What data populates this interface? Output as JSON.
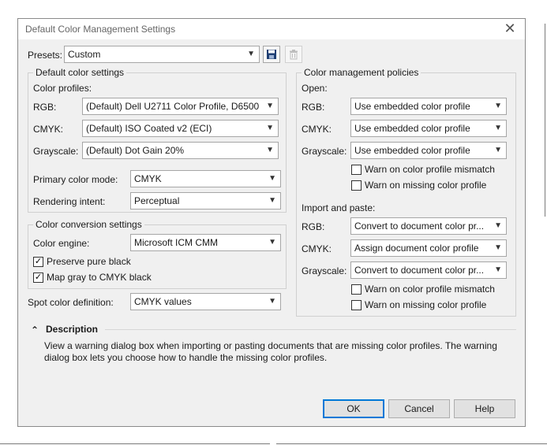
{
  "dialog": {
    "title": "Default Color Management Settings",
    "close_glyph": "✕"
  },
  "presets": {
    "label": "Presets:",
    "value": "Custom"
  },
  "default_color_settings": {
    "legend": "Default color settings",
    "profiles_label": "Color profiles:",
    "rgb_label": "RGB:",
    "rgb_value": "(Default) Dell U2711 Color Profile, D6500",
    "cmyk_label": "CMYK:",
    "cmyk_value": "(Default) ISO Coated v2 (ECI)",
    "gray_label": "Grayscale:",
    "gray_value": "(Default) Dot Gain 20%",
    "primary_label": "Primary color mode:",
    "primary_value": "CMYK",
    "intent_label": "Rendering intent:",
    "intent_value": "Perceptual"
  },
  "conversion": {
    "legend": "Color conversion settings",
    "engine_label": "Color engine:",
    "engine_value": "Microsoft ICM CMM",
    "preserve_black": "Preserve pure black",
    "map_gray": "Map gray to CMYK black"
  },
  "spot": {
    "label": "Spot color definition:",
    "value": "CMYK values"
  },
  "policies": {
    "legend": "Color management policies",
    "open_label": "Open:",
    "rgb_label": "RGB:",
    "open_rgb": "Use embedded color profile",
    "cmyk_label": "CMYK:",
    "open_cmyk": "Use embedded color profile",
    "gray_label": "Grayscale:",
    "open_gray": "Use embedded color profile",
    "warn_mismatch": "Warn on color profile mismatch",
    "warn_missing": "Warn on missing color profile",
    "import_label": "Import and paste:",
    "import_rgb": "Convert to document color pr...",
    "import_cmyk": "Assign document color profile",
    "import_gray": "Convert to document color pr..."
  },
  "description": {
    "toggle_glyph": "⌃",
    "title": "Description",
    "line1": "View a warning dialog box when importing or pasting documents that are missing color profiles.  The warning",
    "line2": "dialog box lets you choose how to handle the missing color profiles."
  },
  "buttons": {
    "ok": "OK",
    "cancel": "Cancel",
    "help": "Help"
  }
}
